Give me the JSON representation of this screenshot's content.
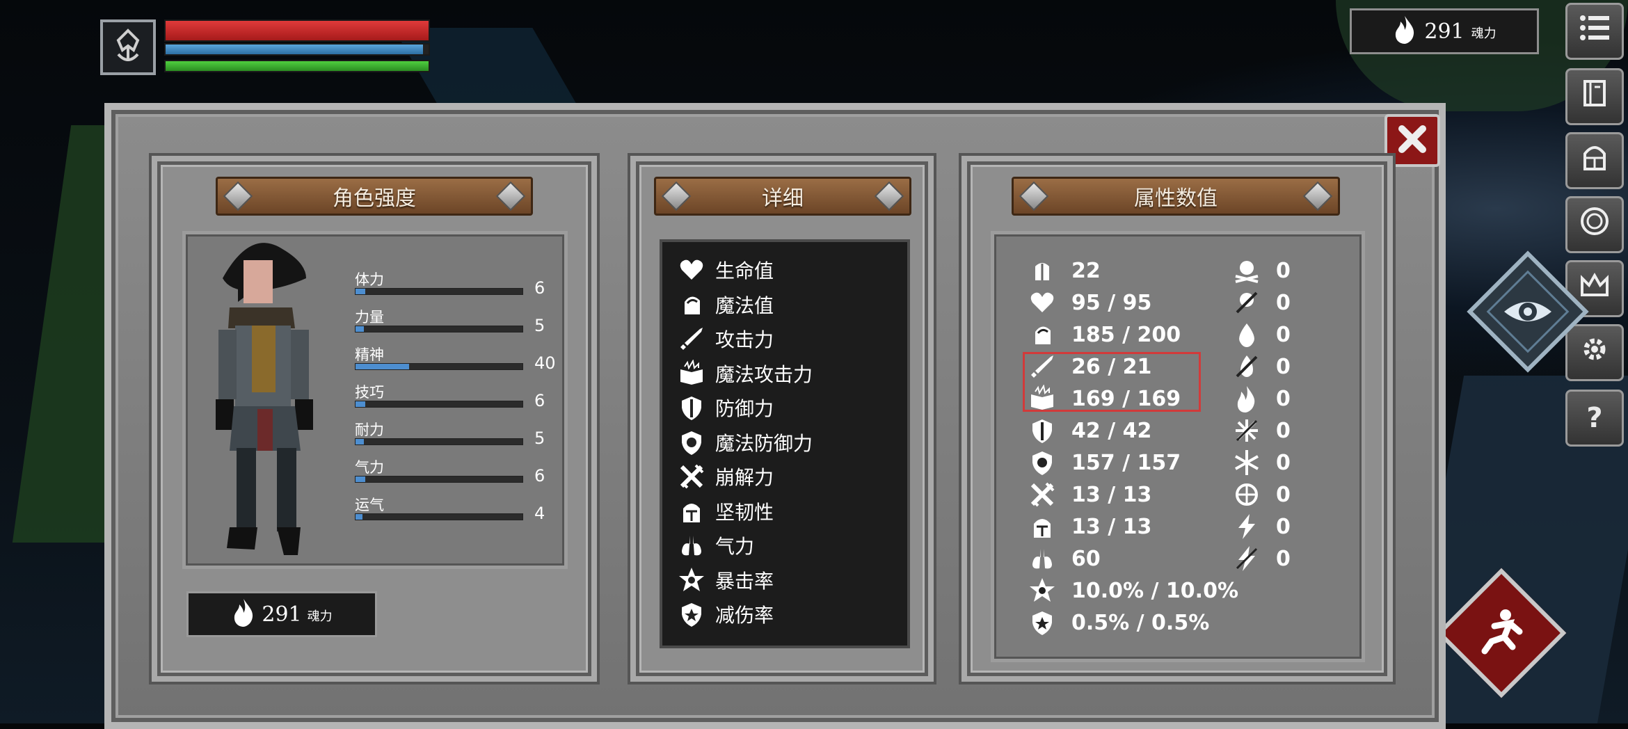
{
  "hud": {
    "hp_fraction": 1.0,
    "mp_fraction": 0.98,
    "stamina_fraction": 1.0,
    "souls": {
      "value": "291",
      "unit": "魂力"
    }
  },
  "side_menu": [
    "menu-icon",
    "inventory-icon",
    "helmet-icon",
    "skills-icon",
    "crown-icon",
    "gear-icon",
    "help-icon"
  ],
  "side_menu_help_label": "?",
  "panel": {
    "character": {
      "title": "角色强度",
      "stats": [
        {
          "label": "体力",
          "value": "6",
          "fill": 0.06
        },
        {
          "label": "力量",
          "value": "5",
          "fill": 0.05
        },
        {
          "label": "精神",
          "value": "40",
          "fill": 0.32
        },
        {
          "label": "技巧",
          "value": "6",
          "fill": 0.06
        },
        {
          "label": "耐力",
          "value": "5",
          "fill": 0.05
        },
        {
          "label": "气力",
          "value": "6",
          "fill": 0.06
        },
        {
          "label": "运气",
          "value": "4",
          "fill": 0.04
        }
      ],
      "souls_button": {
        "value": "291",
        "unit": "魂力"
      }
    },
    "details": {
      "title": "详细",
      "items": [
        {
          "icon": "heart-icon",
          "label": "生命值"
        },
        {
          "icon": "head-icon",
          "label": "魔法值"
        },
        {
          "icon": "sword-icon",
          "label": "攻击力"
        },
        {
          "icon": "spellbook-icon",
          "label": "魔法攻击力"
        },
        {
          "icon": "shield-icon",
          "label": "防御力"
        },
        {
          "icon": "magic-shield-icon",
          "label": "魔法防御力"
        },
        {
          "icon": "break-icon",
          "label": "崩解力"
        },
        {
          "icon": "helmet-icon",
          "label": "坚韧性"
        },
        {
          "icon": "lungs-icon",
          "label": "气力"
        },
        {
          "icon": "crit-star-icon",
          "label": "暴击率"
        },
        {
          "icon": "damage-reduction-icon",
          "label": "减伤率"
        }
      ]
    },
    "attributes": {
      "title": "属性数值",
      "left": [
        {
          "icon": "armor-icon",
          "value": "22"
        },
        {
          "icon": "heart-icon",
          "value": "95 / 95"
        },
        {
          "icon": "head-icon",
          "value": "185 / 200"
        },
        {
          "icon": "sword-icon",
          "value": "26 / 21"
        },
        {
          "icon": "spellbook-icon",
          "value": "169 / 169"
        },
        {
          "icon": "shield-icon",
          "value": "42 / 42"
        },
        {
          "icon": "magic-shield-icon",
          "value": "157 / 157"
        },
        {
          "icon": "break-icon",
          "value": "13 / 13"
        },
        {
          "icon": "helmet-icon",
          "value": "13 / 13"
        },
        {
          "icon": "lungs-icon",
          "value": "60"
        },
        {
          "icon": "crit-star-icon",
          "value": "10.0% / 10.0%"
        },
        {
          "icon": "damage-reduction-icon",
          "value": "0.5% / 0.5%"
        }
      ],
      "right": [
        {
          "icon": "skull-icon",
          "value": "0"
        },
        {
          "icon": "poison-icon",
          "value": "0"
        },
        {
          "icon": "blood-drop-icon",
          "value": "0"
        },
        {
          "icon": "fire-resist-icon",
          "value": "0"
        },
        {
          "icon": "fire-icon",
          "value": "0"
        },
        {
          "icon": "frost-resist-icon",
          "value": "0"
        },
        {
          "icon": "snowflake-icon",
          "value": "0"
        },
        {
          "icon": "frost-icon",
          "value": "0"
        },
        {
          "icon": "lightning-icon",
          "value": "0"
        },
        {
          "icon": "lightning-resist-icon",
          "value": "0"
        }
      ]
    }
  },
  "colors": {
    "hp": "#c62828",
    "mp": "#3b82c4",
    "stamina": "#3fae2f",
    "highlight": "#d23a3a",
    "close": "#8c1717"
  }
}
